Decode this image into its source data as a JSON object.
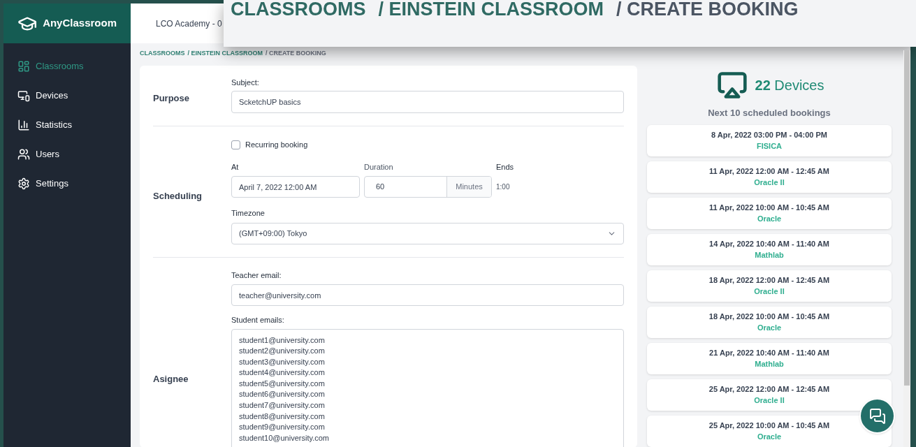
{
  "brand": "AnyClassroom",
  "header": {
    "org": "LCO Academy - 0"
  },
  "zoom_callout": {
    "crumbs": [
      "CLASSROOMS",
      "/ EINSTEIN CLASSROOM",
      "/ CREATE BOOKING"
    ]
  },
  "sidebar": {
    "items": [
      {
        "label": "Classrooms",
        "kind": "grid",
        "selected": true
      },
      {
        "label": "Devices",
        "kind": "devices",
        "selected": false
      },
      {
        "label": "Statistics",
        "kind": "stats",
        "selected": false
      },
      {
        "label": "Users",
        "kind": "users",
        "selected": false
      },
      {
        "label": "Settings",
        "kind": "settings",
        "selected": false
      }
    ]
  },
  "breadcrumb": [
    {
      "label": "CLASSROOMS",
      "current": false
    },
    {
      "label": "/ EINSTEIN CLASSROOM",
      "current": false
    },
    {
      "label": "/ CREATE BOOKING",
      "current": true
    }
  ],
  "form": {
    "purpose": {
      "title": "Purpose",
      "subject_label": "Subject:",
      "subject": "ScketchUP basics"
    },
    "scheduling": {
      "title": "Scheduling",
      "recurring_label": "Recurring booking",
      "recurring": false,
      "at_label": "At",
      "at": "April 7, 2022 12:00 AM",
      "duration_label": "Duration",
      "duration": "60",
      "duration_unit": "Minutes",
      "ends_label": "Ends",
      "ends": "1:00",
      "timezone_label": "Timezone",
      "timezone": "(GMT+09:00) Tokyo"
    },
    "asignee": {
      "title": "Asignee",
      "teacher_label": "Teacher email:",
      "teacher": "teacher@university.com",
      "students_label": "Student emails:",
      "students": [
        "student1@university.com",
        "student2@university.com",
        "student3@university.com",
        "student4@university.com",
        "student5@university.com",
        "student6@university.com",
        "student7@university.com",
        "student8@university.com",
        "student9@university.com",
        "student10@university.com"
      ]
    }
  },
  "devices": {
    "count": "22",
    "label": "Devices",
    "bookings_title": "Next 10 scheduled bookings",
    "bookings": [
      {
        "time": "8 Apr, 2022 03:00 PM - 04:00 PM",
        "subject": "FISICA"
      },
      {
        "time": "11 Apr, 2022 12:00 AM - 12:45 AM",
        "subject": "Oracle II"
      },
      {
        "time": "11 Apr, 2022 10:00 AM - 10:45 AM",
        "subject": "Oracle"
      },
      {
        "time": "14 Apr, 2022 10:40 AM - 11:40 AM",
        "subject": "Mathlab"
      },
      {
        "time": "18 Apr, 2022 12:00 AM - 12:45 AM",
        "subject": "Oracle II"
      },
      {
        "time": "18 Apr, 2022 10:00 AM - 10:45 AM",
        "subject": "Oracle"
      },
      {
        "time": "21 Apr, 2022 10:40 AM - 11:40 AM",
        "subject": "Mathlab"
      },
      {
        "time": "25 Apr, 2022 12:00 AM - 12:45 AM",
        "subject": "Oracle II"
      },
      {
        "time": "25 Apr, 2022 10:00 AM - 10:45 AM",
        "subject": "Oracle"
      }
    ]
  }
}
